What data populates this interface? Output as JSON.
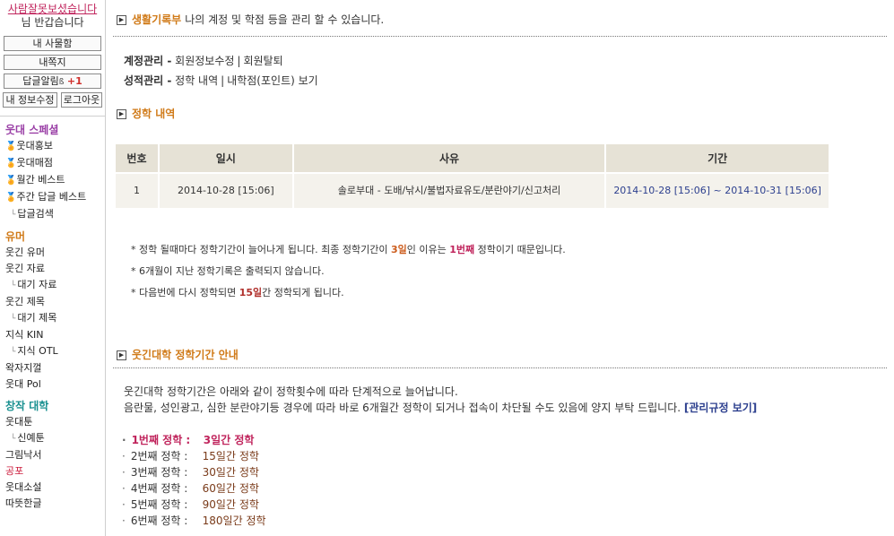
{
  "sidebar": {
    "user_name": "사람잘못보셨습니다",
    "greeting": "님 반갑습니다",
    "buttons": {
      "my_items": "내 사물함",
      "messages": "내쪽지",
      "reply_alert": "답글알림",
      "reply_alert_count": "+1",
      "edit_info": "내 정보수정",
      "logout": "로그아웃"
    },
    "sections": [
      {
        "title": "웃대 스페셜",
        "links": [
          {
            "label": "웃대홍보",
            "medal": true,
            "sub": false
          },
          {
            "label": "웃대매점",
            "medal": true,
            "sub": false
          },
          {
            "label": "월간 베스트",
            "medal": true,
            "sub": false
          },
          {
            "label": "주간 답글 베스트",
            "medal": true,
            "sub": false
          },
          {
            "label": "답글검색",
            "medal": false,
            "sub": true
          }
        ]
      },
      {
        "title": "유머",
        "links": [
          {
            "label": "웃긴 유머",
            "sub": false
          },
          {
            "label": "웃긴 자료",
            "sub": false
          },
          {
            "label": "대기 자료",
            "sub": true
          },
          {
            "label": "웃긴 제목",
            "sub": false
          },
          {
            "label": "대기 제목",
            "sub": true
          },
          {
            "label": "지식 KIN",
            "sub": false
          },
          {
            "label": "지식 OTL",
            "sub": true
          },
          {
            "label": "왁자지껄",
            "sub": false
          },
          {
            "label": "웃대 Pol",
            "sub": false
          }
        ]
      },
      {
        "title": "창작 대학",
        "links": [
          {
            "label": "웃대툰",
            "sub": false
          },
          {
            "label": "신예툰",
            "sub": true
          },
          {
            "label": "그림낙서",
            "sub": false
          },
          {
            "label": "공포",
            "sub": false,
            "red": true
          },
          {
            "label": "웃대소설",
            "sub": false
          },
          {
            "label": "따뜻한글",
            "sub": false
          }
        ]
      }
    ]
  },
  "header": {
    "title": "생활기록부",
    "description": "나의 계정 및 학점 등을 관리 할 수 있습니다."
  },
  "account_menu": {
    "label": "계정관리 -",
    "links": [
      "회원정보수정",
      "회원탈퇴"
    ]
  },
  "grade_menu": {
    "label": "성적관리 -",
    "links": [
      "정학 내역",
      "내학점(포인트) 보기"
    ]
  },
  "suspension_section": {
    "title": "정학 내역",
    "columns": [
      "번호",
      "일시",
      "사유",
      "기간"
    ],
    "rows": [
      {
        "no": "1",
        "datetime": "2014-10-28 [15:06]",
        "reason": "솔로부대 - 도배/낚시/불법자료유도/분란야기/신고처리",
        "period": "2014-10-28 [15:06] ~ 2014-10-31 [15:06]"
      }
    ],
    "notes": {
      "note1_a": "* 정학 될때마다 정학기간이 늘어나게 됩니다. 최종 정학기간이 ",
      "note1_days": "3일",
      "note1_b": "인 이유는 ",
      "note1_count": "1번째",
      "note1_c": " 정학이기 때문입니다.",
      "note2": "* 6개월이 지난 정학기록은 출력되지 않습니다.",
      "note3_a": "* 다음번에 다시 정학되면 ",
      "note3_days": "15일",
      "note3_b": "간 정학되게 됩니다."
    }
  },
  "policy_section": {
    "title": "웃긴대학 정학기간 안내",
    "intro_line1": "웃긴대학 정학기간은 아래와 같이 정학횟수에 따라 단계적으로 늘어납니다.",
    "intro_line2": "음란물, 성인광고, 심한 분란야기등 경우에 따라 바로 6개월간 정학이 되거나 접속이 차단될 수도 있음에 양지 부탁 드립니다.",
    "rules_link": "[관리규정 보기]",
    "rules": [
      {
        "label": "1번째 정학 :",
        "duration": "3일간 정학"
      },
      {
        "label": "2번째 정학 :",
        "duration": "15일간 정학"
      },
      {
        "label": "3번째 정학 :",
        "duration": "30일간 정학"
      },
      {
        "label": "4번째 정학 :",
        "duration": "60일간 정학"
      },
      {
        "label": "5번째 정학 :",
        "duration": "90일간 정학"
      },
      {
        "label": "6번째 정학 :",
        "duration": "180일간 정학"
      }
    ]
  }
}
